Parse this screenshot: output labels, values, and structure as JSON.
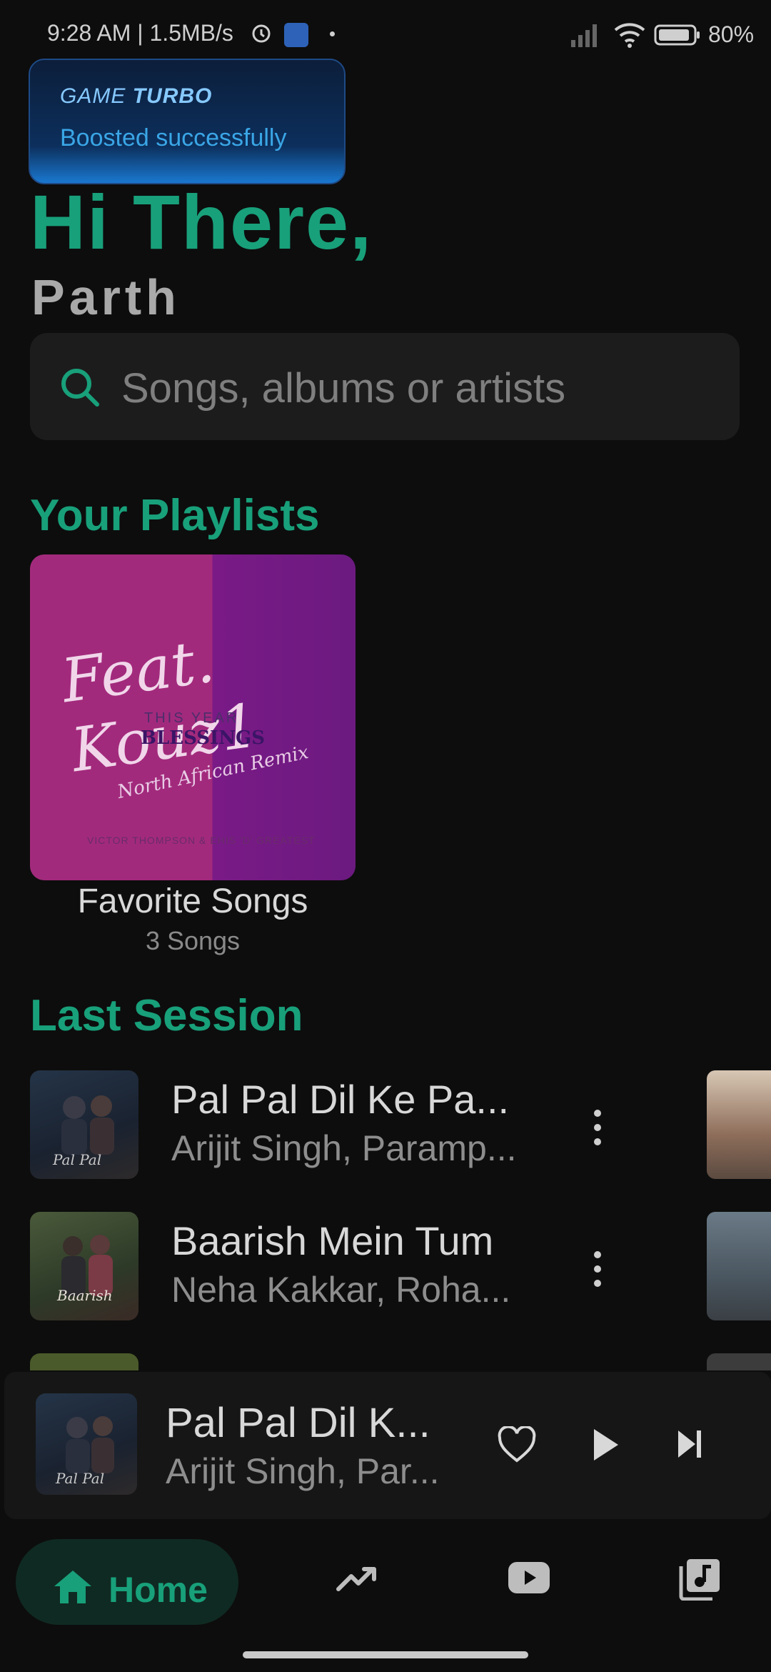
{
  "status_bar": {
    "time": "9:28 AM | 1.5MB/s",
    "battery": "80%"
  },
  "toast": {
    "title_game": "GAME",
    "title_turbo": "TURBO",
    "message": "Boosted successfully"
  },
  "greeting": {
    "line1": "Hi There,",
    "line2": "Parth"
  },
  "search": {
    "placeholder": "Songs, albums or artists"
  },
  "playlists_section": {
    "title": "Your Playlists",
    "items": [
      {
        "name": "Favorite Songs",
        "count": "3 Songs",
        "art": {
          "feat": "Feat. Kouz1",
          "year": "THIS YEAR",
          "blessings": "BLESSINGS",
          "remix": "North African Remix",
          "credits": "VICTOR THOMPSON & EHIS 'D' GREATEST"
        }
      }
    ]
  },
  "last_session": {
    "title": "Last Session",
    "items": [
      {
        "title": "Pal Pal Dil Ke Pa...",
        "artist": "Arijit Singh, Paramp..."
      },
      {
        "title": "Baarish Mein Tum",
        "artist": "Neha Kakkar, Roha..."
      }
    ]
  },
  "mini_player": {
    "title": "Pal Pal Dil K...",
    "artist": "Arijit Singh, Par..."
  },
  "bottom_nav": {
    "home_label": "Home"
  },
  "colors": {
    "accent": "#18a07a",
    "background": "#0d0d0d"
  }
}
